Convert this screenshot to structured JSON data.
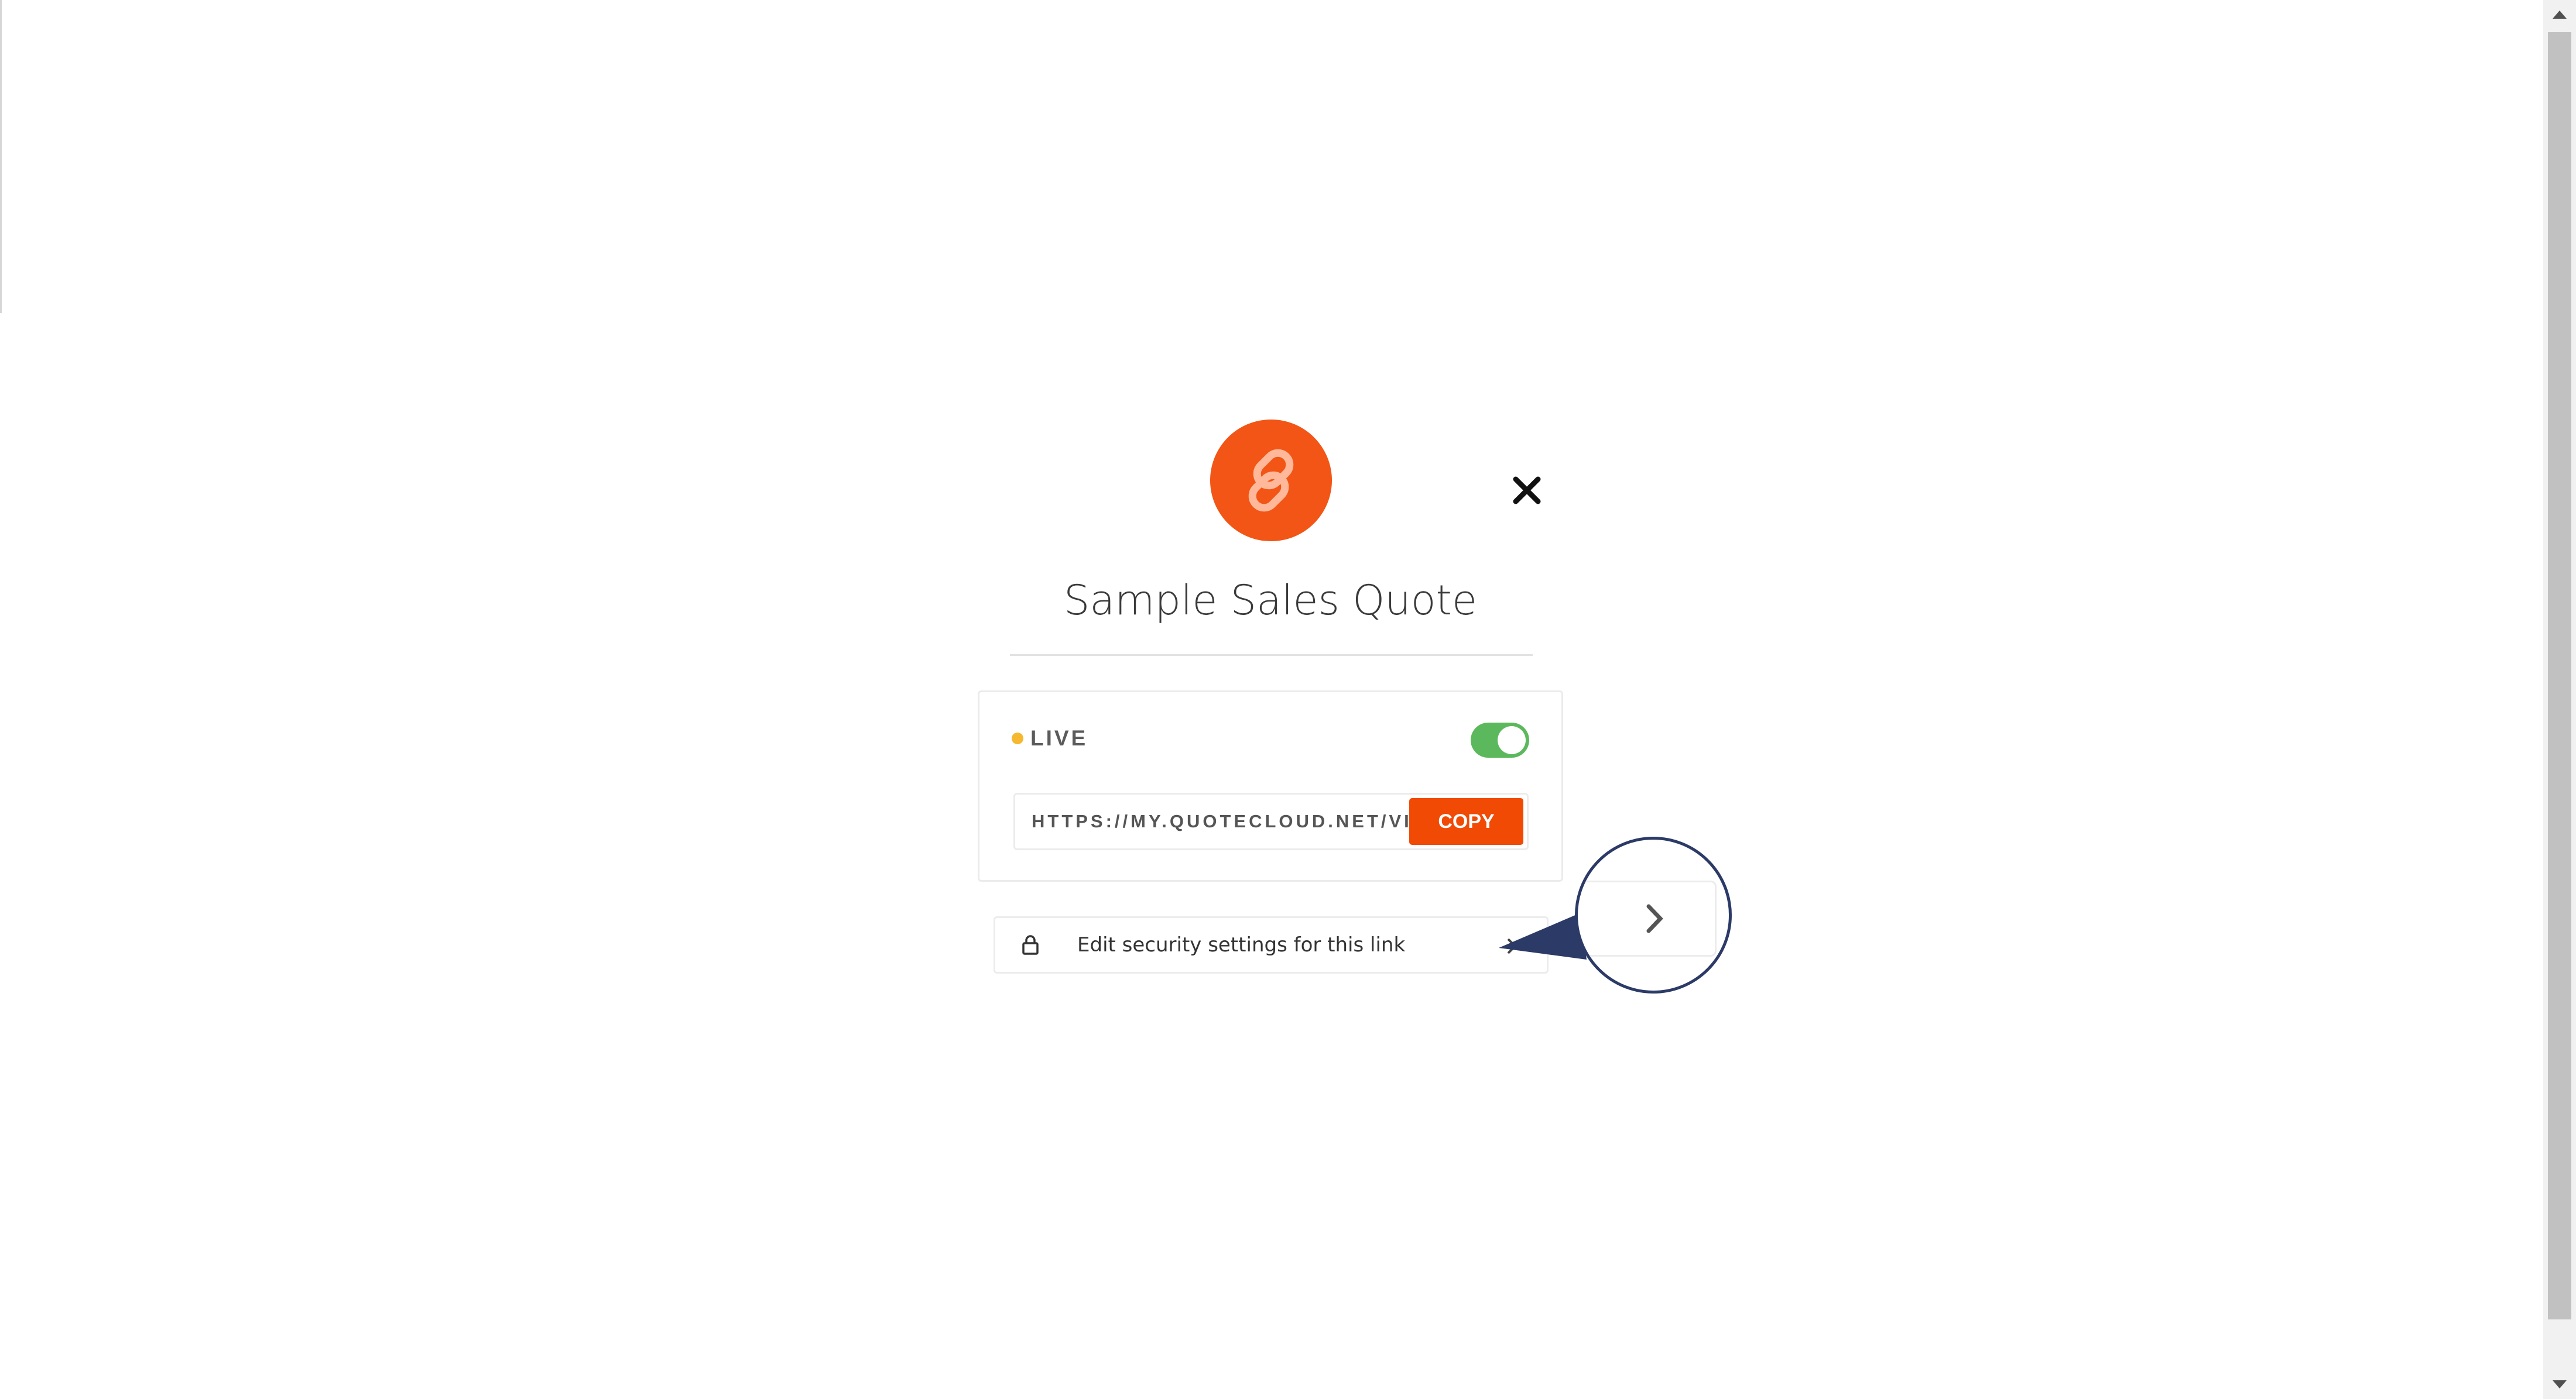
{
  "dialog": {
    "title": "Sample Sales Quote",
    "logo_icon": "link-icon",
    "close_icon": "close-icon"
  },
  "status": {
    "label": "LIVE",
    "dot_color": "#f5b82e",
    "toggle_on": true,
    "toggle_color": "#5cb85c"
  },
  "share": {
    "url": "HTTPS://MY.QUOTECLOUD.NET/VIE...",
    "copy_label": "COPY"
  },
  "security": {
    "label": "Edit security settings for this link",
    "icon": "lock-icon",
    "chevron": "chevron-right-icon"
  },
  "colors": {
    "brand": "#f25515",
    "copy_button": "#f04a05",
    "callout_border": "#2b3a66"
  }
}
